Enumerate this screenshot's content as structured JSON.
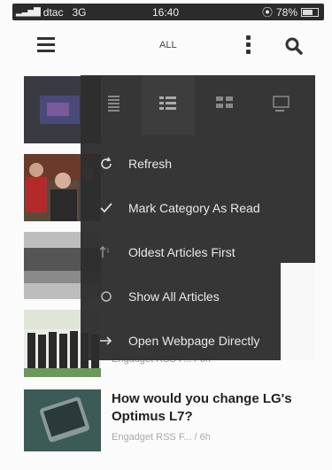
{
  "status_bar": {
    "signal": "▂▃▅▇",
    "carrier": "dtac",
    "network": "3G",
    "time": "16:40",
    "battery": "78%"
  },
  "header": {
    "title": "ALL"
  },
  "view_modes": [
    "list-view-icon",
    "compact-view-icon",
    "grid-view-icon",
    "card-view-icon"
  ],
  "menu": {
    "items": [
      {
        "label": "Refresh",
        "icon": "refresh-icon"
      },
      {
        "label": "Mark Category As Read",
        "icon": "checkmark-icon"
      },
      {
        "label": "Oldest Articles First",
        "icon": "sort-icon"
      },
      {
        "label": "Show All Articles",
        "icon": "circle-icon"
      },
      {
        "label": "Open Webpage Directly",
        "icon": "arrow-right-icon"
      }
    ]
  },
  "articles": [
    {
      "title": "",
      "source": ""
    },
    {
      "title": "",
      "source": ""
    },
    {
      "title": "",
      "source": ""
    },
    {
      "title": "",
      "source": "Engadget RSS F... / 6h"
    },
    {
      "title": "How would you change LG's Optimus L7?",
      "source": "Engadget RSS F... / 6h"
    }
  ],
  "colors": {
    "overlay": "#2e2e2e",
    "status_bar": "#2b2b2b",
    "text_dark": "#222222"
  }
}
